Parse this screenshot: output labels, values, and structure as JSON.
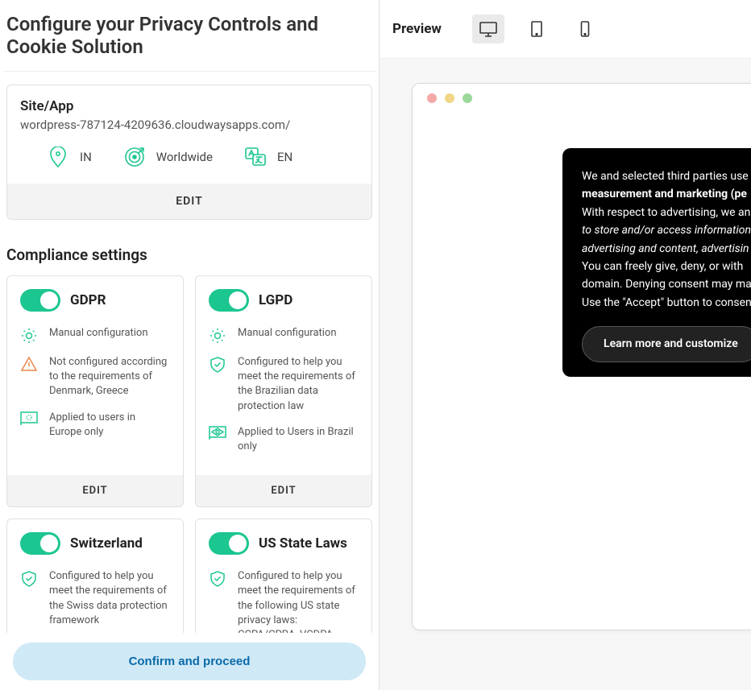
{
  "page": {
    "title": "Configure your Privacy Controls and Cookie Solution"
  },
  "site": {
    "label": "Site/App",
    "url": "wordpress-787124-4209636.cloudwaysapps.com/",
    "location": "IN",
    "reach": "Worldwide",
    "language": "EN",
    "edit_label": "EDIT"
  },
  "compliance": {
    "title": "Compliance settings",
    "edit_label": "EDIT",
    "cards": [
      {
        "name": "GDPR",
        "config": "Manual configuration",
        "status": "Not configured according to the requirements of Denmark, Greece",
        "status_warn": true,
        "applied": "Applied to users in Europe only",
        "show_edit": true
      },
      {
        "name": "LGPD",
        "config": "Manual configuration",
        "status": "Configured to help you meet the requirements of the Brazilian data protection law",
        "status_warn": false,
        "applied": "Applied to Users in Brazil only",
        "show_edit": true
      },
      {
        "name": "Switzerland",
        "config": "",
        "status": "Configured to help you meet the requirements of the Swiss data protection framework",
        "status_warn": false,
        "applied": "",
        "show_edit": false
      },
      {
        "name": "US State Laws",
        "config": "",
        "status": "Configured to help you meet the requirements of the following US state privacy laws: CCPA/CPRA, VCDPA",
        "status_warn": false,
        "applied": "",
        "show_edit": false
      }
    ]
  },
  "confirm_label": "Confirm and proceed",
  "preview": {
    "label": "Preview",
    "banner": {
      "line1_pre": "We and selected third parties use ",
      "line1_bold": "measurement and marketing (pe",
      "line2_pre": "With respect to advertising, we an",
      "line2_ital1": "to store and/or access information ",
      "line2_ital2": "advertising and content, advertisin",
      "line3": "You can freely give, deny, or with",
      "line4": "domain. Denying consent may ma",
      "line5": "Use the \"Accept\" button to consen",
      "btn": "Learn more and customize"
    }
  }
}
